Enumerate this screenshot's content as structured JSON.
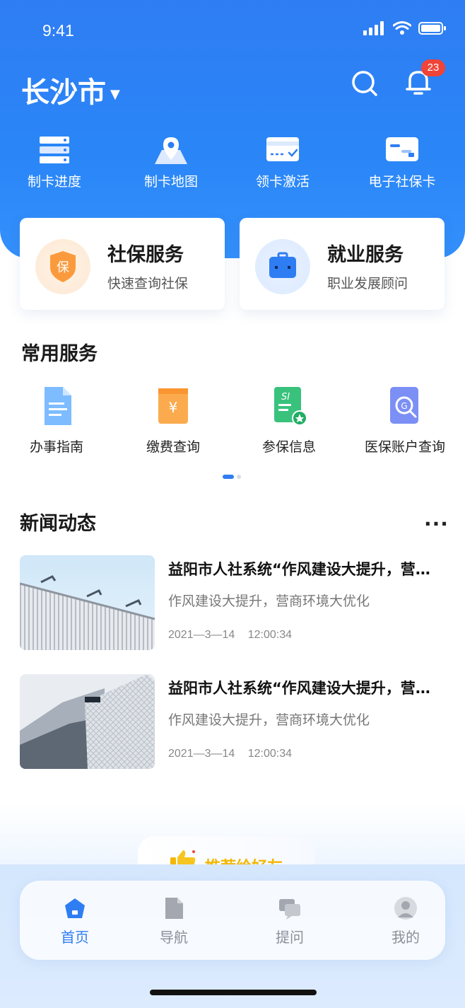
{
  "status_bar": {
    "time": "9:41"
  },
  "header": {
    "city": "长沙市",
    "notification_count": "23"
  },
  "quick_actions": [
    {
      "label": "制卡进度",
      "icon": "server-list-icon"
    },
    {
      "label": "制卡地图",
      "icon": "map-pin-icon"
    },
    {
      "label": "领卡激活",
      "icon": "card-activate-icon"
    },
    {
      "label": "电子社保卡",
      "icon": "ecard-icon"
    }
  ],
  "service_cards": [
    {
      "title": "社保服务",
      "subtitle": "快速查询社保",
      "icon": "shield-icon",
      "icon_text": "保"
    },
    {
      "title": "就业服务",
      "subtitle": "职业发展顾问",
      "icon": "briefcase-icon"
    }
  ],
  "common_services": {
    "title": "常用服务",
    "items": [
      {
        "label": "办事指南",
        "icon": "document-icon"
      },
      {
        "label": "缴费查询",
        "icon": "payment-icon",
        "icon_text": "¥"
      },
      {
        "label": "参保信息",
        "icon": "insurance-info-icon",
        "icon_text": "SI"
      },
      {
        "label": "医保账户查询",
        "icon": "medical-account-icon",
        "icon_text": "G"
      }
    ]
  },
  "news": {
    "title": "新闻动态",
    "items": [
      {
        "title": "益阳市人社系统“作风建设大提升，营商环境大优化”",
        "summary": "作风建设大提升，营商环境大优化",
        "date": "2021—3—14",
        "time": "12:00:34"
      },
      {
        "title": "益阳市人社系统“作风建设大提升，营商环境大优化”",
        "summary": "作风建设大提升，营商环境大优化",
        "date": "2021—3—14",
        "time": "12:00:34"
      }
    ]
  },
  "promo": {
    "label": "推荐给好友"
  },
  "tab_bar": [
    {
      "label": "首页",
      "active": true,
      "icon": "home-icon"
    },
    {
      "label": "导航",
      "active": false,
      "icon": "file-icon"
    },
    {
      "label": "提问",
      "active": false,
      "icon": "chat-icon"
    },
    {
      "label": "我的",
      "active": false,
      "icon": "user-icon"
    }
  ],
  "colors": {
    "brand": "#2f7df3",
    "badge": "#f04438",
    "promo": "#f2b705"
  }
}
